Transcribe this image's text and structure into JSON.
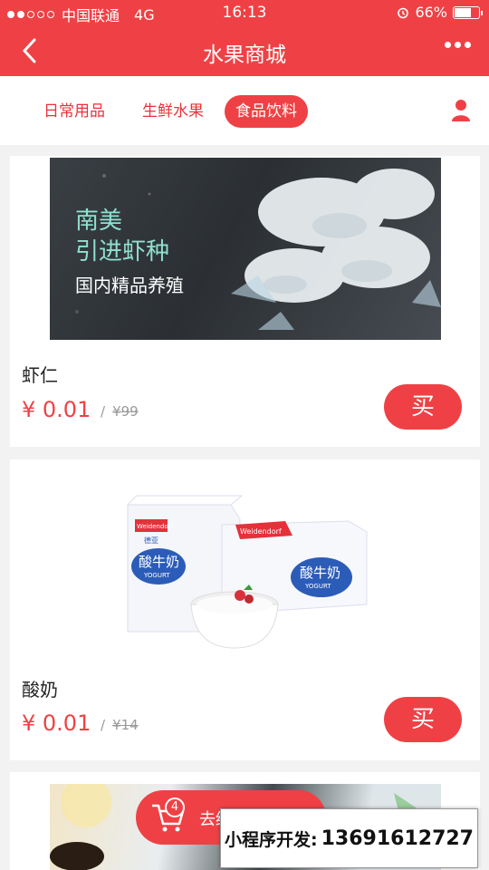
{
  "status_bar": {
    "carrier": "中国联通",
    "network": "4G",
    "time": "16:13",
    "battery": "66%"
  },
  "nav": {
    "title": "水果商城"
  },
  "tabs": [
    {
      "label": "日常用品",
      "active": false
    },
    {
      "label": "生鲜水果",
      "active": false
    },
    {
      "label": "食品饮料",
      "active": true
    }
  ],
  "products": [
    {
      "name": "虾仁",
      "price": "¥ 0.01",
      "original_price": "¥99",
      "buy_label": "买",
      "image_text": {
        "line1": "南美",
        "line2": "引进虾种",
        "line3": "国内精品养殖"
      }
    },
    {
      "name": "酸奶",
      "price": "¥ 0.01",
      "original_price": "¥14",
      "buy_label": "买",
      "image_text": {
        "brand": "Weidendorf",
        "brand_cn": "德亚",
        "product": "酸牛奶",
        "sub": "YOGURT"
      }
    }
  ],
  "cart": {
    "count": "4",
    "label": "去结算"
  },
  "overlay": {
    "label": "小程序开发:",
    "phone": "13691612727"
  },
  "colors": {
    "accent": "#ef4145"
  }
}
